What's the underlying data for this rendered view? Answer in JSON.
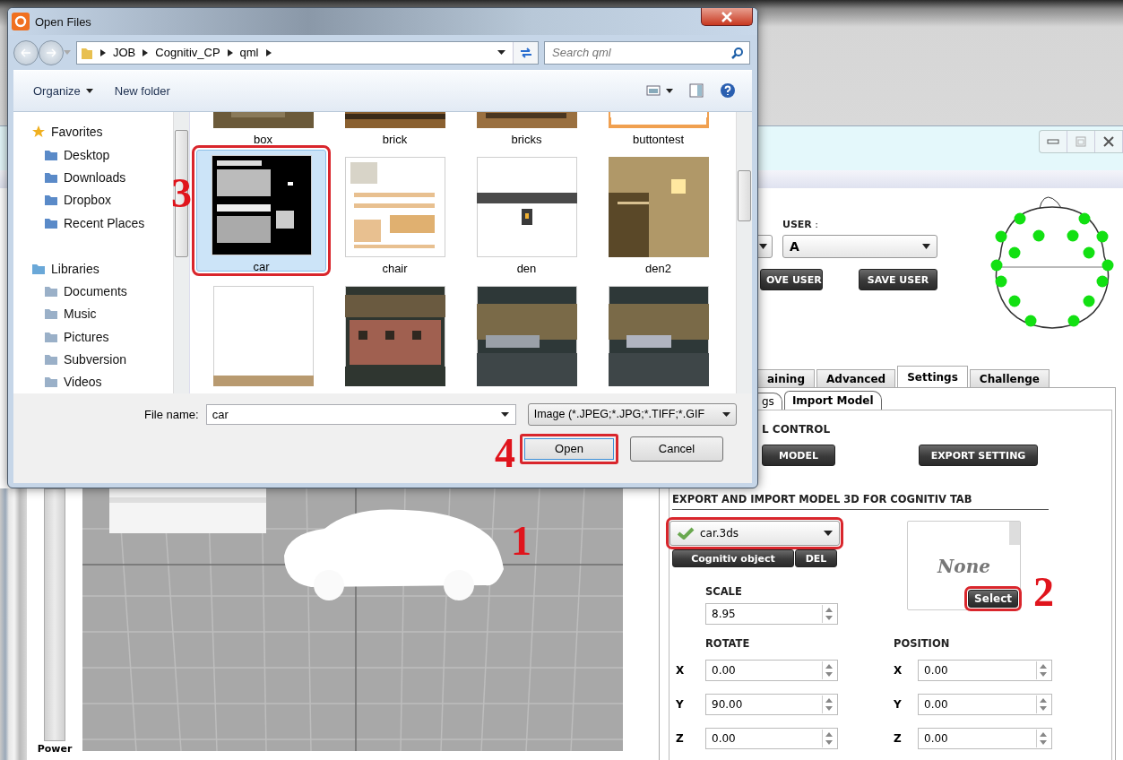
{
  "dialog": {
    "title": "Open Files",
    "breadcrumb": [
      "JOB",
      "Cognitiv_CP",
      "qml"
    ],
    "search": {
      "placeholder": "Search qml"
    },
    "toolbar": [
      "Organize",
      "New folder"
    ],
    "nav": [
      {
        "label": "Favorites",
        "children": [
          {
            "label": "Desktop"
          },
          {
            "label": "Downloads"
          },
          {
            "label": "Dropbox"
          },
          {
            "label": "Recent Places"
          }
        ]
      },
      {
        "label": "Libraries",
        "children": [
          {
            "label": "Documents"
          },
          {
            "label": "Music"
          },
          {
            "label": "Pictures"
          },
          {
            "label": "Subversion"
          },
          {
            "label": "Videos"
          }
        ]
      }
    ],
    "files": [
      {
        "name": "box",
        "kind": "picture",
        "selected": false,
        "highlighted": false
      },
      {
        "name": "brick",
        "kind": "picture",
        "selected": false,
        "highlighted": false
      },
      {
        "name": "bricks",
        "kind": "picture",
        "selected": false,
        "highlighted": false
      },
      {
        "name": "buttontest",
        "kind": "picture",
        "selected": false,
        "highlighted": false
      },
      {
        "name": "car",
        "kind": "picture",
        "selected": true,
        "highlighted": true,
        "annotation": "3"
      },
      {
        "name": "chair",
        "kind": "picture",
        "selected": false,
        "highlighted": false
      },
      {
        "name": "den",
        "kind": "picture",
        "selected": false,
        "highlighted": false
      },
      {
        "name": "den2",
        "kind": "picture",
        "selected": false,
        "highlighted": false
      },
      {
        "kind": "picture",
        "selected": false,
        "highlighted": false
      },
      {
        "kind": "picture",
        "selected": false,
        "highlighted": false
      },
      {
        "kind": "picture",
        "selected": false,
        "highlighted": false
      },
      {
        "kind": "picture",
        "selected": false,
        "highlighted": false
      }
    ],
    "file_name": {
      "label": "File name:",
      "value": "car"
    },
    "file_type": "Image (*.JPEG;*.JPG;*.TIFF;*.GIF",
    "buttons": [
      {
        "label": "Open",
        "highlighted": true,
        "annotation": "4"
      },
      {
        "label": "Cancel",
        "highlighted": false
      }
    ]
  },
  "app": {
    "user": {
      "label": "**USER** :",
      "value": "A"
    },
    "user_buttons": [
      "OVE USER",
      "SAVE USER"
    ],
    "tabs": [
      {
        "label": "aining",
        "selected": false
      },
      {
        "label": "Advanced",
        "selected": false
      },
      {
        "label": "Settings",
        "selected": true
      },
      {
        "label": "Challenge",
        "selected": false
      }
    ],
    "subtabs": [
      {
        "label": "gs",
        "selected": false
      },
      {
        "label": "Import Model",
        "selected": true
      }
    ],
    "section": "L CONTROL",
    "actions": [
      "MODEL",
      "EXPORT SETTING"
    ],
    "heading": "EXPORT AND IMPORT MODEL 3D FOR COGNITIV TAB",
    "model": {
      "value": "car.3ds",
      "checked": true,
      "highlighted": true
    },
    "model_buttons": [
      "Cognitiv object",
      "DEL"
    ],
    "preview": {
      "text": "None",
      "button": {
        "label": "Select",
        "highlighted": true,
        "annotation": "2"
      }
    },
    "scale": {
      "label": "SCALE",
      "value": "8.95"
    },
    "rotate": {
      "label": "ROTATE",
      "fields": [
        {
          "axis": "X",
          "value": "0.00"
        },
        {
          "axis": "Y",
          "value": "90.00"
        },
        {
          "axis": "Z",
          "value": "0.00"
        }
      ]
    },
    "position": {
      "label": "POSITION",
      "fields": [
        {
          "axis": "X",
          "value": "0.00"
        },
        {
          "axis": "Y",
          "value": "0.00"
        },
        {
          "axis": "Z",
          "value": "0.00"
        }
      ]
    },
    "viewport": {
      "power_label": "Power",
      "annotation": "1"
    }
  }
}
